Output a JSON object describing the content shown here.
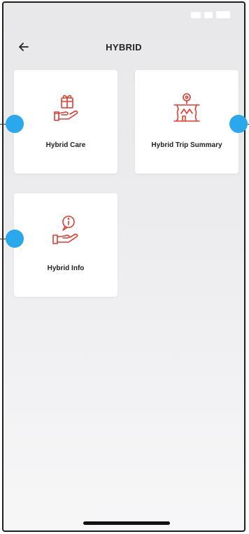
{
  "header": {
    "title": "HYBRID",
    "back_icon": "back-arrow-icon"
  },
  "cards": [
    {
      "label": "Hybrid Care",
      "icon": "hand-with-gift-icon"
    },
    {
      "label": "Hybrid Trip Summary",
      "icon": "route-pin-icon"
    },
    {
      "label": "Hybrid Info",
      "icon": "hand-with-info-icon"
    }
  ],
  "colors": {
    "accent": "#e23b2e",
    "marker": "#2aa8ee",
    "text": "#222222",
    "card_bg": "#ffffff"
  }
}
